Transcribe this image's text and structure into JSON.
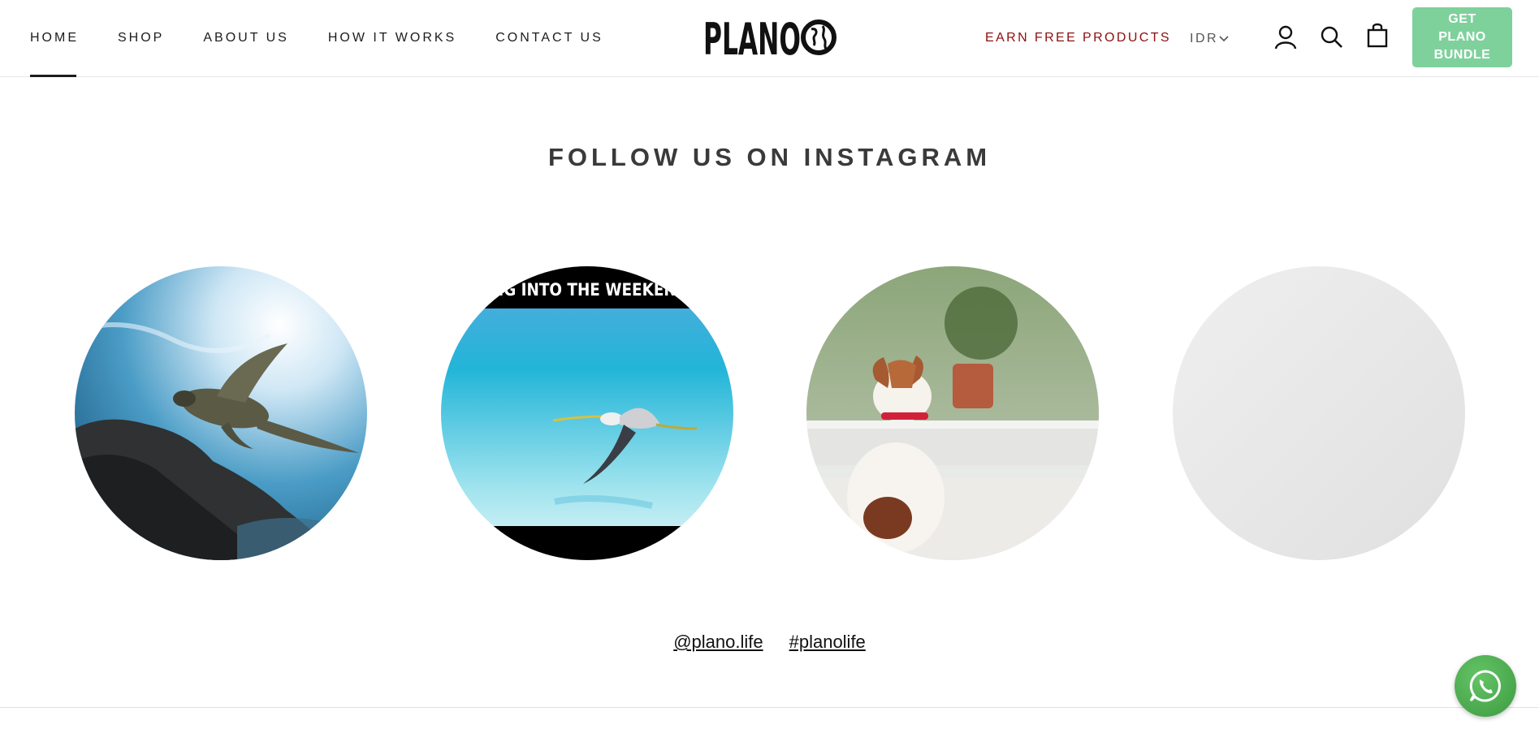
{
  "header": {
    "nav": [
      "HOME",
      "SHOP",
      "ABOUT US",
      "HOW IT WORKS",
      "CONTACT US"
    ],
    "active_nav": "HOME",
    "logo_text": "PLANO",
    "earn_label": "EARN FREE PRODUCTS",
    "currency": "IDR",
    "icons": [
      "account-icon",
      "search-icon",
      "cart-icon"
    ],
    "bundle_button_label": "GET PLANO BUNDLE"
  },
  "instagram": {
    "title": "FOLLOW US ON INSTAGRAM",
    "posts": [
      {
        "subject": "sea turtle swimming",
        "caption": ""
      },
      {
        "subject": "heron flying over sea",
        "caption": "ING INTO THE WEEKEND"
      },
      {
        "subject": "dog looking out window",
        "caption": ""
      },
      {
        "subject": "loading placeholder",
        "caption": ""
      }
    ],
    "handle": "@plano.life",
    "hashtag": "#planolife"
  },
  "colors": {
    "accent_red": "#8b0f0f",
    "bundle_green": "#7fd19c",
    "whatsapp_green": "#4caf50"
  },
  "widgets": {
    "chat_icon": "whatsapp-icon"
  }
}
